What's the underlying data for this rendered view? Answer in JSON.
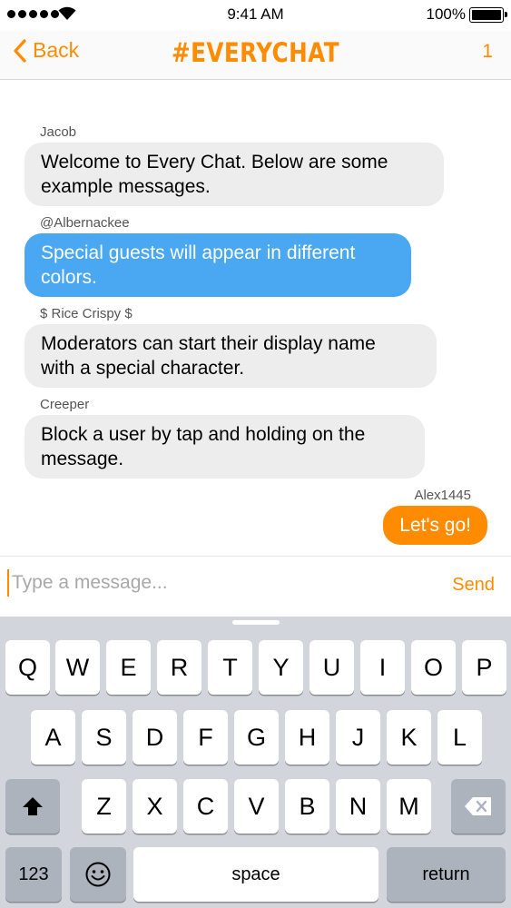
{
  "status_bar": {
    "time": "9:41 AM",
    "battery": "100%"
  },
  "nav": {
    "back_label": "Back",
    "title": "#EVERYCHAT",
    "count": "1"
  },
  "messages": [
    {
      "sender": "Jacob",
      "lines": [
        "Welcome to Every Chat. Below are some",
        "example messages."
      ],
      "style": "gray"
    },
    {
      "sender": "@Albernackee",
      "lines": [
        "Special guests will appear in different",
        "colors."
      ],
      "style": "blue",
      "color": "#4aa8f2"
    },
    {
      "sender": "$ Rice Crispy $",
      "lines": [
        "Moderators can start their display name",
        "with a special character."
      ],
      "style": "gray"
    },
    {
      "sender": "Creeper",
      "lines": [
        "Block a user by tap and holding on the",
        "message."
      ],
      "style": "gray"
    },
    {
      "sender": "Alex1445",
      "lines": [
        "Let's go!"
      ],
      "style": "orange",
      "color": "#ff8c00"
    }
  ],
  "composer": {
    "placeholder": "Type a message...",
    "value": "",
    "send_label": "Send"
  },
  "keyboard": {
    "row1": [
      "Q",
      "W",
      "E",
      "R",
      "T",
      "Y",
      "U",
      "I",
      "O",
      "P"
    ],
    "row2": [
      "A",
      "S",
      "D",
      "F",
      "G",
      "H",
      "J",
      "K",
      "L"
    ],
    "row3": [
      "Z",
      "X",
      "C",
      "V",
      "B",
      "N",
      "M"
    ],
    "numbers_label": "123",
    "space_label": "space",
    "return_label": "return",
    "shift_icon": "shift-arrow-icon",
    "delete_icon": "backspace-icon",
    "emoji_icon": "emoji-smiley-icon"
  },
  "colors": {
    "accent": "#ff8c00",
    "guest_blue": "#4aa8f2",
    "bubble_gray": "#ededed",
    "keyboard_bg": "#d2d5db"
  }
}
